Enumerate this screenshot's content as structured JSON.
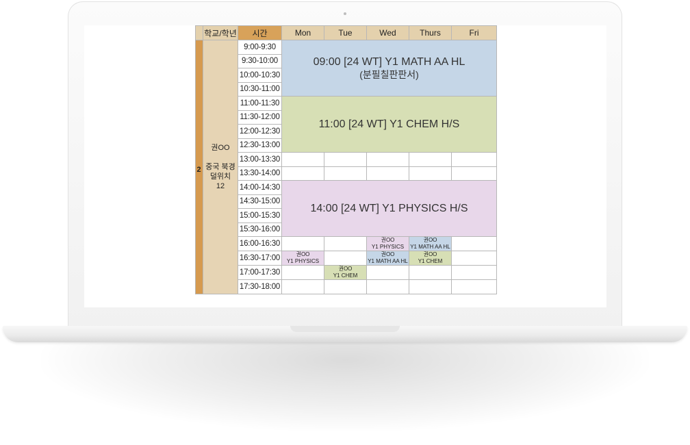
{
  "timetable": {
    "headers": {
      "school_grade": "학교/학년",
      "time": "시간",
      "days": [
        "Mon",
        "Tue",
        "Wed",
        "Thurs",
        "Fri"
      ]
    },
    "student": {
      "number": "2",
      "name": "권OO",
      "school": "중국 북경 덜위치",
      "grade": "12"
    },
    "time_slots": [
      "9:00-9:30",
      "9:30-10:00",
      "10:00-10:30",
      "10:30-11:00",
      "11:00-11:30",
      "11:30-12:00",
      "12:00-12:30",
      "12:30-13:00",
      "13:00-13:30",
      "13:30-14:00",
      "14:00-14:30",
      "14:30-15:00",
      "15:00-15:30",
      "15:30-16:00",
      "16:00-16:30",
      "16:30-17:00",
      "17:00-17:30",
      "17:30-18:00"
    ],
    "blocks": {
      "math": {
        "title": "09:00 [24 WT] Y1 MATH AA HL",
        "subtitle": "(분필칠판판서)",
        "color": "#c5d6e7"
      },
      "chem": {
        "title": "11:00 [24 WT] Y1 CHEM H/S",
        "color": "#d7dfb5"
      },
      "physics": {
        "title": "14:00 [24 WT] Y1 PHYSICS H/S",
        "color": "#e8d7ea"
      }
    },
    "small_sessions": {
      "wed_1600": {
        "name": "권OO",
        "subject": "Y1 PHYSICS"
      },
      "thu_1600": {
        "name": "권OO",
        "subject": "Y1 MATH AA HL"
      },
      "mon_1630": {
        "name": "권OO",
        "subject": "Y1 PHYSICS"
      },
      "wed_1630": {
        "name": "권OO",
        "subject": "Y1 MATH AA HL"
      },
      "thu_1630": {
        "name": "권OO",
        "subject": "Y1 CHEM"
      },
      "tue_1700": {
        "name": "권OO",
        "subject": "Y1 CHEM"
      }
    }
  }
}
